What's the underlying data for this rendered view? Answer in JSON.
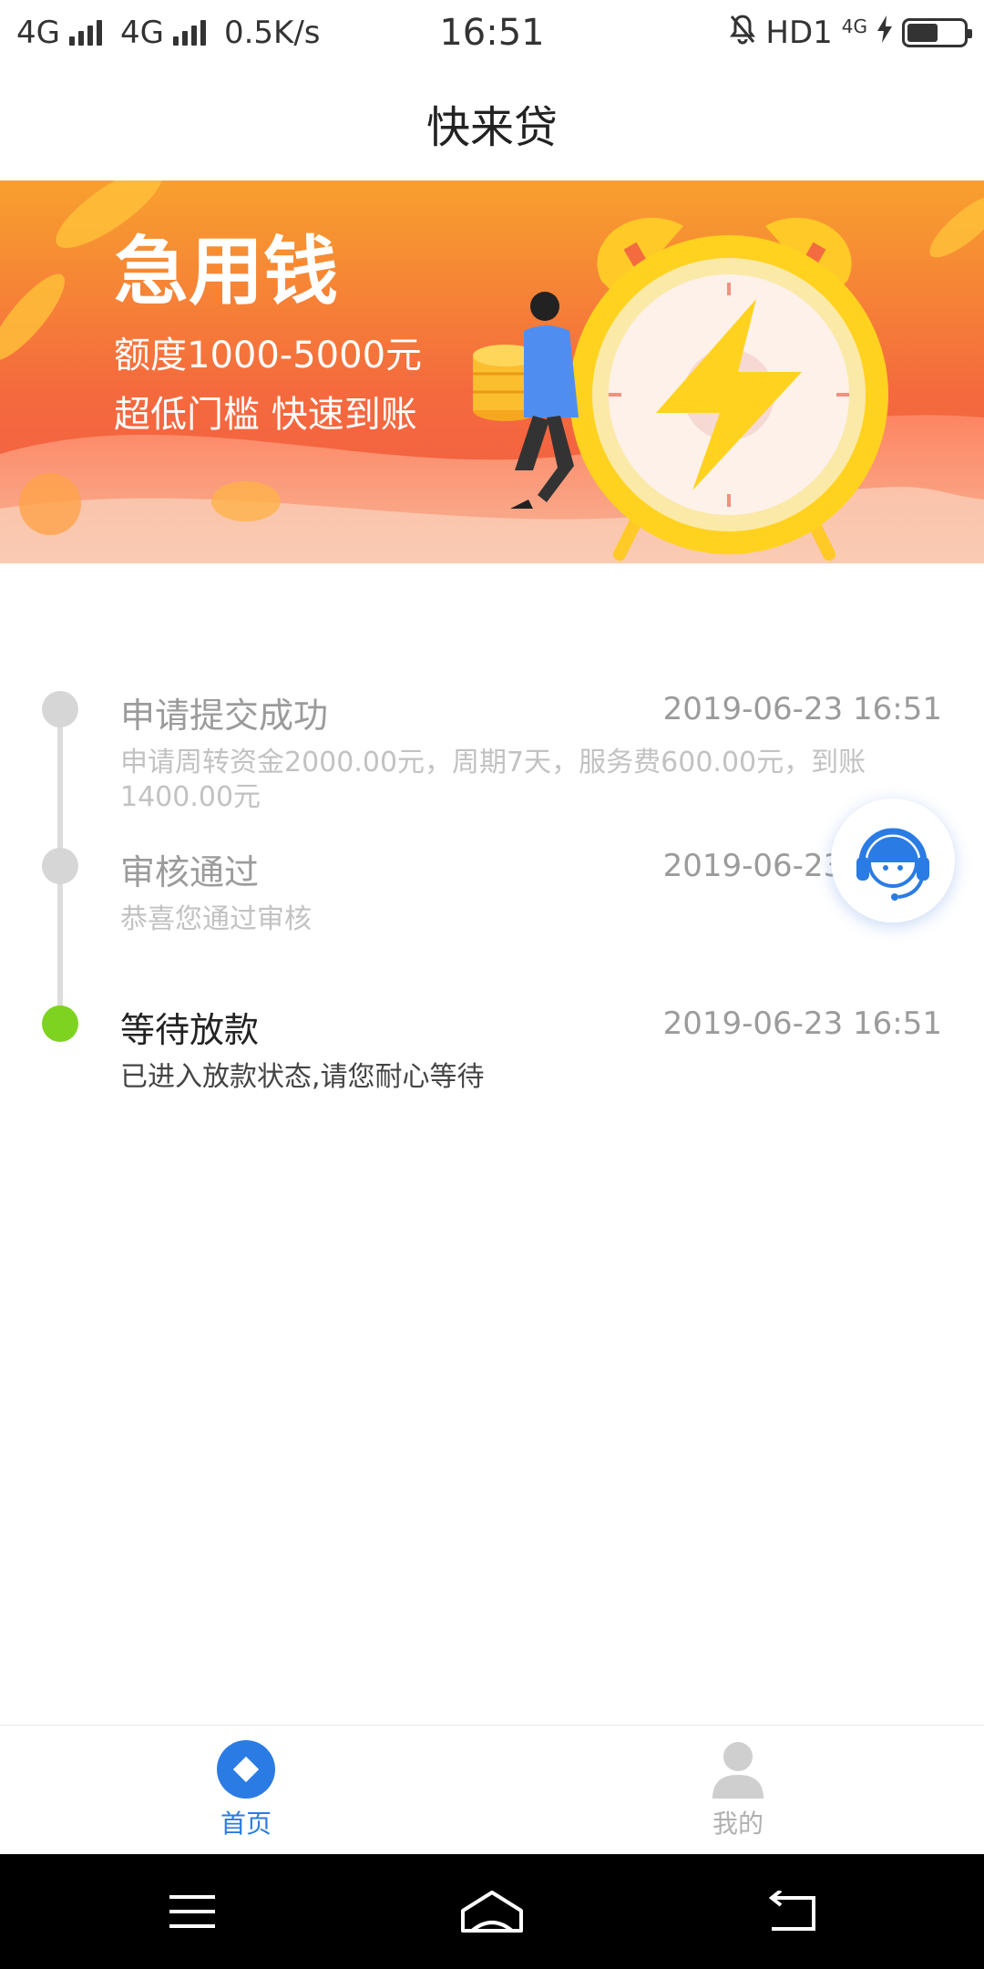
{
  "status_bar": {
    "network1": "4G",
    "network2": "4G",
    "speed": "0.5K/s",
    "time": "16:51",
    "hd": "HD1",
    "net_small": "4G",
    "battery_level": 0.55
  },
  "header": {
    "title": "快来贷"
  },
  "banner": {
    "headline": "急用钱",
    "line1": "额度1000-5000元",
    "line2": "超低门槛 快速到账"
  },
  "timeline": [
    {
      "title": "申请提交成功",
      "time": "2019-06-23 16:51",
      "desc": "申请周转资金2000.00元，周期7天，服务费600.00元，到账1400.00元",
      "active": false
    },
    {
      "title": "审核通过",
      "time": "2019-06-23 16:51",
      "desc": "恭喜您通过审核",
      "active": false
    },
    {
      "title": "等待放款",
      "time": "2019-06-23 16:51",
      "desc": "已进入放款状态,请您耐心等待",
      "active": true
    }
  ],
  "tabs": {
    "home": "首页",
    "mine": "我的"
  },
  "colors": {
    "accent": "#2a7be4",
    "active_dot": "#7ed321",
    "inactive_dot": "#d6d6d6"
  },
  "icons": [
    "headset-icon",
    "home-tab-icon",
    "user-tab-icon",
    "menu-icon",
    "home-nav-icon",
    "back-icon"
  ]
}
